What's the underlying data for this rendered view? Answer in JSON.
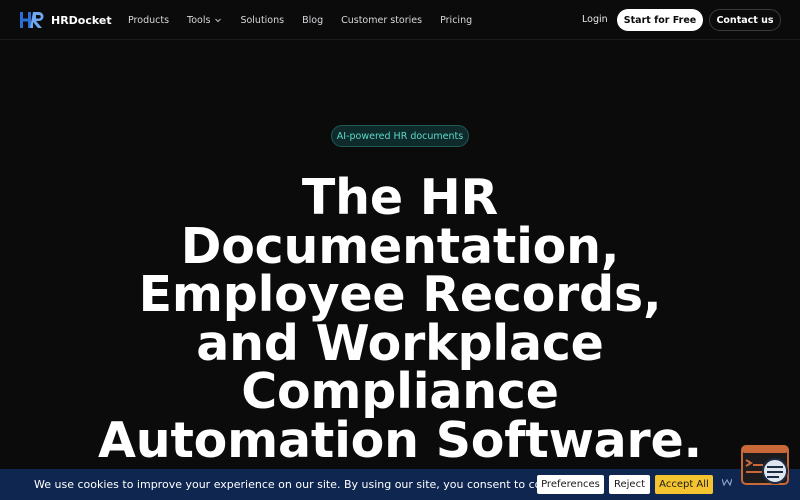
{
  "brand": {
    "name": "HRDocket",
    "accent": "#2a6fd6"
  },
  "nav": {
    "items": [
      {
        "label": "Products"
      },
      {
        "label": "Tools"
      },
      {
        "label": "Solutions"
      },
      {
        "label": "Blog"
      },
      {
        "label": "Customer stories"
      },
      {
        "label": "Pricing"
      }
    ],
    "login_label": "Login",
    "start_label": "Start for Free",
    "contact_label": "Contact us"
  },
  "hero": {
    "badge": "AI-powered HR documents",
    "headline_lines": [
      "The HR",
      "Documentation,",
      "Employee Records,",
      "and Workplace",
      "Compliance",
      "Automation Software."
    ]
  },
  "cookie": {
    "message": "We use cookies to improve your experience on our site. By using our site, you consent to cookies.",
    "preferences_label": "Preferences",
    "reject_label": "Reject",
    "accept_label": "Accept All",
    "background": "#0f2650",
    "accept_color": "#f4c430"
  },
  "icons": {
    "logo": "hr-logo-icon",
    "chevron": "chevron-down-icon",
    "chat": "chat-widget-icon"
  }
}
